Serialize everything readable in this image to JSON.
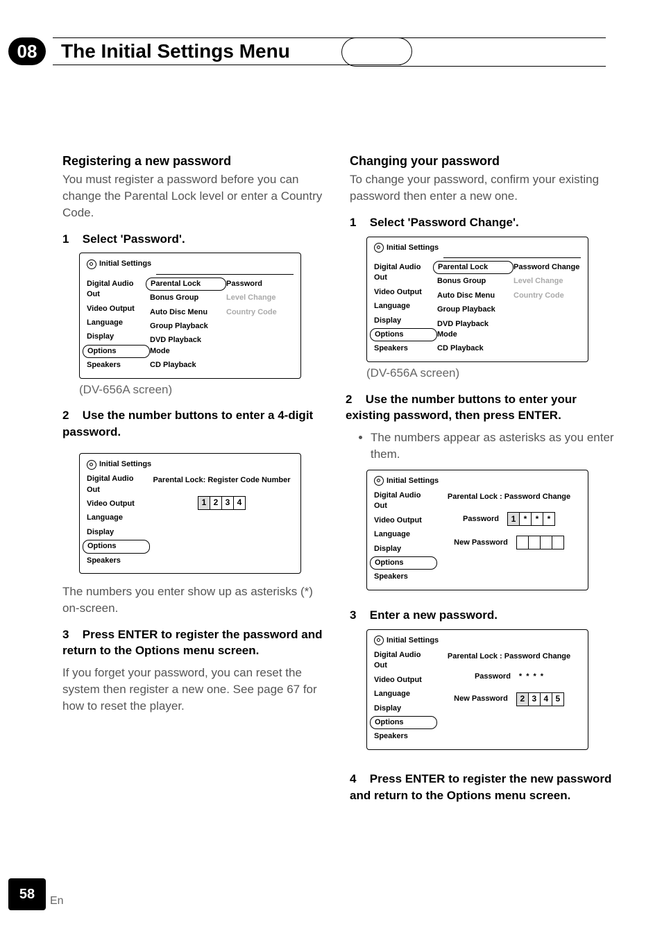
{
  "header": {
    "chapter_number": "08",
    "chapter_title": "The Initial Settings Menu"
  },
  "footer": {
    "page_number": "58",
    "language": "En"
  },
  "left": {
    "section_heading": "Registering a new password",
    "intro": "You must register a password before you can change the Parental Lock level or enter a Country Code.",
    "step1_num": "1",
    "step1_text": "Select 'Password'.",
    "ui1": {
      "title": "Initial Settings",
      "sidebar": [
        "Digital Audio Out",
        "Video Output",
        "Language",
        "Display",
        "Options",
        "Speakers"
      ],
      "mid": [
        "Parental Lock",
        "Bonus Group",
        "Auto Disc Menu",
        "Group Playback",
        "DVD Playback Mode",
        "CD Playback"
      ],
      "right": [
        "Password",
        "Level Change",
        "Country Code"
      ]
    },
    "caption1": "(DV-656A screen)",
    "step2_num": "2",
    "step2_text": "Use the number buttons to enter a 4-digit password.",
    "ui2": {
      "title": "Initial Settings",
      "sidebar": [
        "Digital Audio Out",
        "Video Output",
        "Language",
        "Display",
        "Options",
        "Speakers"
      ],
      "center_title": "Parental Lock: Register Code Number",
      "code": [
        "1",
        "2",
        "3",
        "4"
      ]
    },
    "after2": "The numbers you enter show up as asterisks (*) on-screen.",
    "step3_num": "3",
    "step3_text": "Press ENTER to register the password and return to the Options menu screen.",
    "after3a": "If you forget your password, you can reset the system then register a new one. See ",
    "after3b_bold": "page 67",
    "after3c": " for how to reset the player."
  },
  "right": {
    "section_heading": "Changing your password",
    "intro": "To change your password, confirm your existing password then enter a new one.",
    "step1_num": "1",
    "step1_text": "Select 'Password Change'.",
    "ui1": {
      "title": "Initial Settings",
      "sidebar": [
        "Digital Audio Out",
        "Video Output",
        "Language",
        "Display",
        "Options",
        "Speakers"
      ],
      "mid": [
        "Parental Lock",
        "Bonus Group",
        "Auto Disc Menu",
        "Group Playback",
        "DVD Playback Mode",
        "CD Playback"
      ],
      "right": [
        "Password Change",
        "Level Change",
        "Country Code"
      ]
    },
    "caption1": "(DV-656A screen)",
    "step2_num": "2",
    "step2_text": "Use the number buttons to enter your existing password, then press ENTER.",
    "bullet": "The numbers appear as asterisks as you enter them.",
    "ui2": {
      "title": "Initial Settings",
      "sidebar": [
        "Digital Audio Out",
        "Video Output",
        "Language",
        "Display",
        "Options",
        "Speakers"
      ],
      "center_title": "Parental Lock : Password Change",
      "pwd_label": "Password",
      "newpwd_label": "New Password",
      "pwd_code": [
        "1",
        "*",
        "*",
        "*"
      ],
      "new_code": [
        "",
        "",
        "",
        ""
      ]
    },
    "step3_num": "3",
    "step3_text": "Enter a new password.",
    "ui3": {
      "title": "Initial Settings",
      "sidebar": [
        "Digital Audio Out",
        "Video Output",
        "Language",
        "Display",
        "Options",
        "Speakers"
      ],
      "center_title": "Parental Lock : Password Change",
      "pwd_label": "Password",
      "newpwd_label": "New Password",
      "pwd_code": [
        "*",
        "*",
        "*",
        "*"
      ],
      "new_code": [
        "2",
        "3",
        "4",
        "5"
      ]
    },
    "step4_num": "4",
    "step4_text": "Press ENTER to register the new password and return to the Options menu screen."
  }
}
